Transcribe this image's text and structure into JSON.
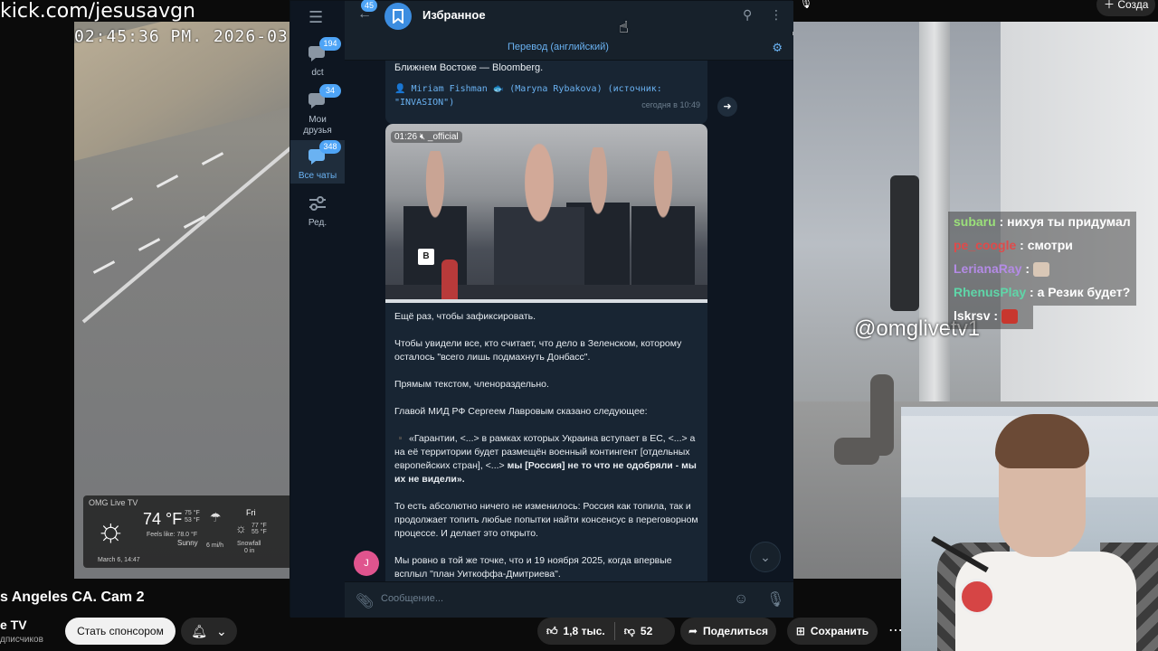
{
  "stream": {
    "url": "kick.com/jesusavgn",
    "timestamp": "02:45:36 PM.  2026-03-0",
    "watermark": "@omglivetv1"
  },
  "weather": {
    "brand": "OMG Live TV",
    "temp": "74 °F",
    "hi": "75 °F",
    "lo": "53 °F",
    "feels": "Feels like: 78.0 °F",
    "condition": "Sunny",
    "wind": "6 mi/h",
    "day": "Fri",
    "day_hi": "77 °F",
    "day_lo": "55 °F",
    "day_cond": "Snowfall",
    "day_amt": "0 in",
    "date": "March 6, 14:47"
  },
  "chat": [
    {
      "nick": "subaru",
      "color": "#9be07a",
      "text": "нихуя ты придумал"
    },
    {
      "nick": "pe_coogle",
      "color": "#e04a4a",
      "text": "смотри"
    },
    {
      "nick": "LerianaRay",
      "color": "#b48be6",
      "text": ""
    },
    {
      "nick": "RhenusPlay",
      "color": "#5fd6a8",
      "text": "а Резик будет?"
    },
    {
      "nick": "lskrsv",
      "color": "#ffffff",
      "text": ""
    }
  ],
  "telegram": {
    "folders": [
      {
        "label": "dct",
        "badge": "194"
      },
      {
        "label": "Мои друзья",
        "badge": "34"
      },
      {
        "label": "Все чаты",
        "badge": "348"
      },
      {
        "label": "Ред.",
        "badge": ""
      }
    ],
    "back_badge": "45",
    "chat_title": "Избранное",
    "translate_label": "Перевод (английский)",
    "prev_message": {
      "text": "Ближнем Востоке — Bloomberg.",
      "source": "👤 Miriam Fishman 🐟 (Maryna Rybakova) (источник: \"INVASION\")",
      "time": "сегодня в 10:49"
    },
    "video": {
      "duration": "01:26",
      "channel_tag": "_official"
    },
    "message": {
      "p1": "Ещё раз, чтобы зафиксировать.",
      "p2": "Чтобы увидели все, кто считает, что дело в Зеленском, которому осталось \"всего лишь подмахнуть Донбасс\".",
      "p3": "Прямым текстом, членораздельно.",
      "p4": "Главой МИД РФ Сергеем Лавровым сказано следующее:",
      "p5a": "▪️ «Гарантии, <...> в рамках которых Украина вступает в ЕС, <...> а на её территории будет размещён военный контингент [отдельных европейских стран], <...> ",
      "p5b": "мы [Россия] не то что не одобряли - мы их не видели».",
      "p6": "То есть абсолютно ничего не изменилось: Россия как топила, так и продолжает топить любые попытки найти консенсус в переговорном процессе. И делает это открыто.",
      "p7": "Мы ровно в той же точке, что и 19 ноября 2025, когда впервые всплыл \"план Уиткоффа-Дмитриева\"."
    },
    "sender_initial": "J",
    "input_placeholder": "Сообщение..."
  },
  "youtube": {
    "title": "s Angeles CA. Cam 2",
    "channel": "e TV",
    "subs": "дписчиков",
    "sponsor_label": "Стать спонсором",
    "likes": "1,8 тыс.",
    "dislikes": "52",
    "share_label": "Поделиться",
    "save_label": "Сохранить",
    "create_label": "Созда"
  }
}
